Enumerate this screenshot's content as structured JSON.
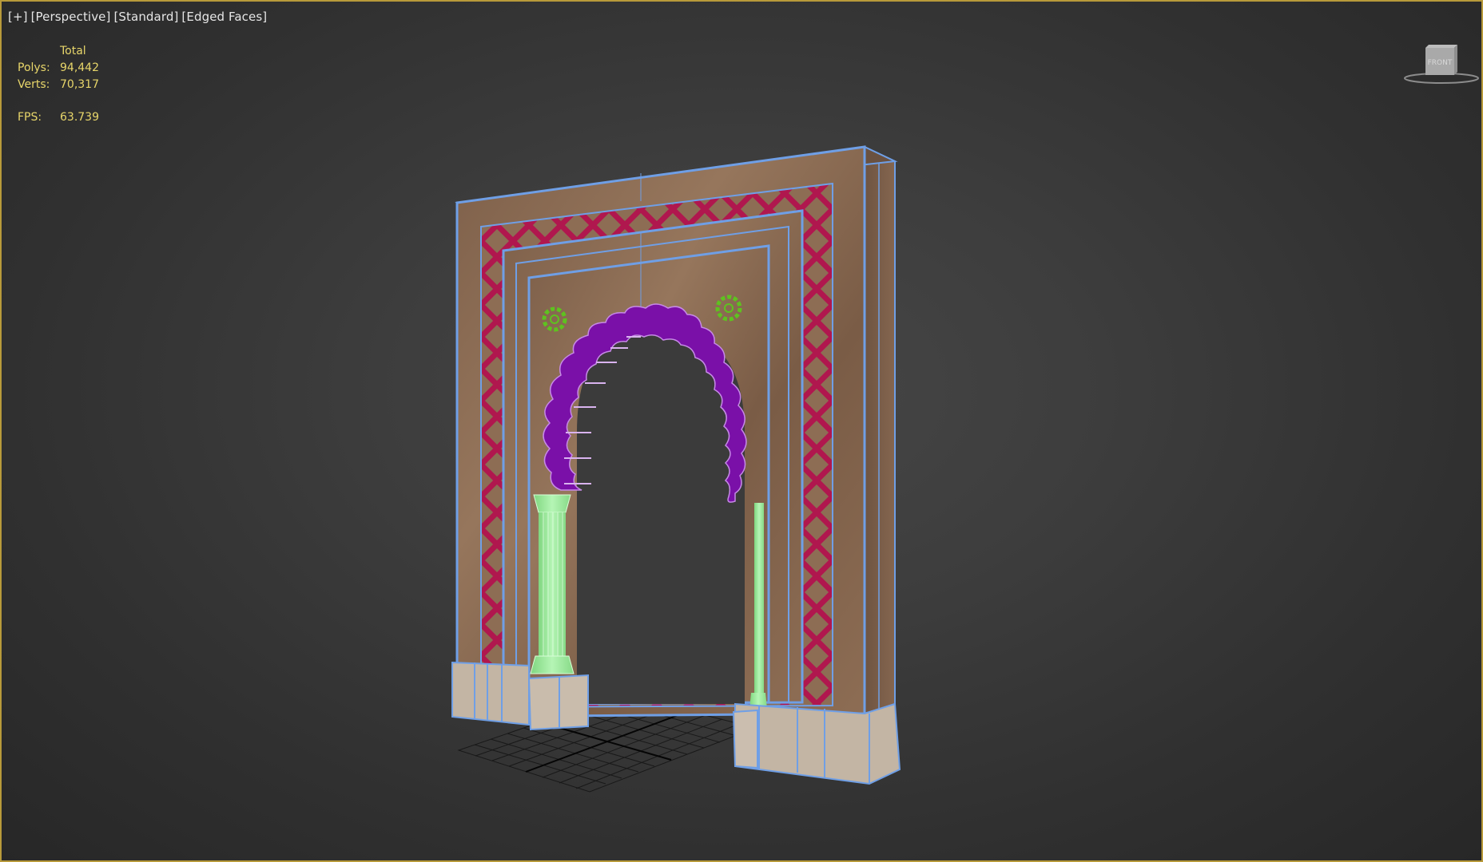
{
  "viewport": {
    "labels": [
      "[+]",
      "[Perspective]",
      "[Standard]",
      "[Edged Faces]"
    ],
    "border_color": "#b89a3a"
  },
  "stats": {
    "header": "Total",
    "polys_label": "Polys:",
    "polys_value": "94,442",
    "verts_label": "Verts:",
    "verts_value": "70,317",
    "fps_label": "FPS:",
    "fps_value": "63.739",
    "text_color": "#e8d66a"
  },
  "viewcube": {
    "label": "FRONT",
    "icon": "viewcube-icon"
  },
  "scene": {
    "object": "arch-model",
    "colors": {
      "frame": "#8a6a50",
      "edges": "#6f9fe6",
      "lattice": "#b0174e",
      "arch_scallops": "#7a10a8",
      "columns": "#9be89b",
      "rosettes": "#5ec21f",
      "base_blocks": "#c3b5a4",
      "grid": "#101010"
    }
  }
}
